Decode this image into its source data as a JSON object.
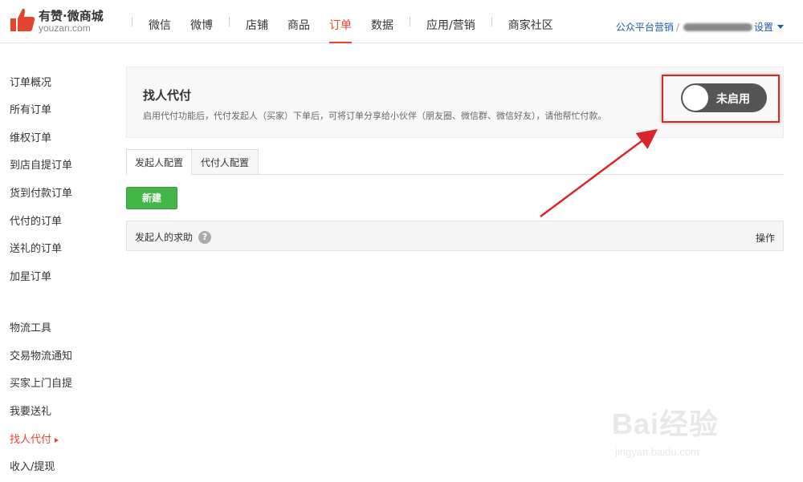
{
  "header": {
    "brand": "有赞·微商城",
    "domain": "youzan.com",
    "nav": [
      "微信",
      "微博",
      "店铺",
      "商品",
      "订单",
      "数据",
      "应用/营销",
      "商家社区"
    ],
    "active_nav": "订单",
    "right_link": "公众平台营销",
    "settings": "设置"
  },
  "sidebar": {
    "groups": [
      [
        "订单概况",
        "所有订单",
        "维权订单",
        "到店自提订单",
        "货到付款订单",
        "代付的订单",
        "送礼的订单",
        "加星订单"
      ],
      [
        "物流工具",
        "交易物流通知",
        "买家上门自提",
        "我要送礼",
        "找人代付",
        "收入/提现"
      ]
    ],
    "active": "找人代付"
  },
  "feature": {
    "title": "找人代付",
    "description": "启用代付功能后，代付发起人（买家）下单后，可将订单分享给小伙伴（朋友圈、微信群、微信好友），请他帮忙付款。",
    "toggle_label": "未启用",
    "enabled": false
  },
  "tabs": [
    "发起人配置",
    "代付人配置"
  ],
  "active_tab": "发起人配置",
  "new_button": "新建",
  "table": {
    "headers": [
      "发起人的求助",
      "操作"
    ],
    "help_icon": "?"
  },
  "watermark": {
    "text": "Bai经验",
    "url": "jingyan.baidu.com"
  },
  "colors": {
    "accent": "#e5452f",
    "link": "#1e5aa8",
    "green": "#44b549",
    "toggle_off": "#555555",
    "highlight": "#d9262b"
  }
}
